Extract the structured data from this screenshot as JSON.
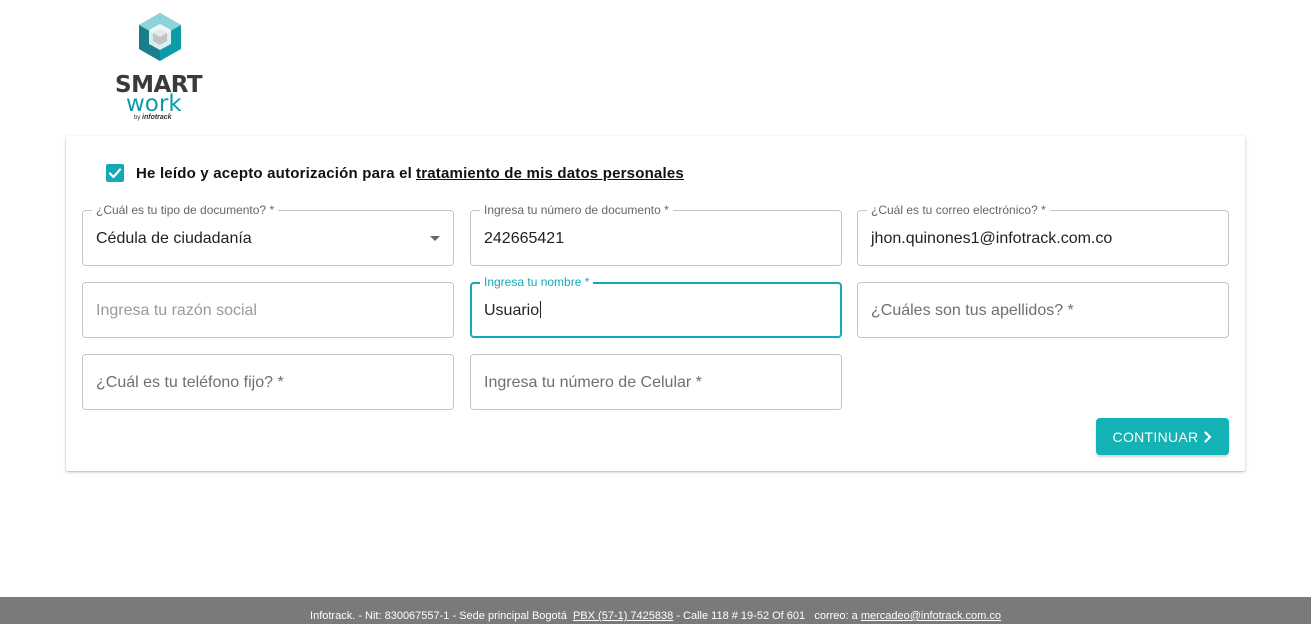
{
  "brand": {
    "line1": "SMART",
    "line2": "work",
    "by_prefix": "by",
    "by_name": "infotrack",
    "primary_color": "#12aab8",
    "dark_color": "#3a3a3a"
  },
  "consent": {
    "checked": true,
    "text": "He leído y acepto autorización para el",
    "link_text": "tratamiento de mis datos personales"
  },
  "fields": {
    "doc_type": {
      "label": "¿Cuál es tu tipo de documento? *",
      "value": "Cédula de ciudadanía"
    },
    "doc_number": {
      "label": "Ingresa tu número de documento *",
      "value": "242665421"
    },
    "email": {
      "label": "¿Cuál es tu correo electrónico? *",
      "value": "jhon.quinones1@infotrack.com.co"
    },
    "business_name": {
      "placeholder": "Ingresa tu razón social"
    },
    "first_name": {
      "label": "Ingresa tu nombre *",
      "value": "Usuario"
    },
    "last_names": {
      "placeholder": "¿Cuáles son tus apellidos? *"
    },
    "landline": {
      "placeholder": "¿Cuál es tu teléfono fijo? *"
    },
    "mobile": {
      "placeholder": "Ingresa tu número de Celular *"
    }
  },
  "actions": {
    "continue_label": "CONTINUAR",
    "button_color": "#12b2b5"
  },
  "footer": {
    "company": "Infotrack. - Nit: 830067557-1 - Sede principal Bogotá",
    "phone": "PBX (57-1) 7425838",
    "address": "- Calle 118 # 19-52 Of 601",
    "email_prefix": "correo: a",
    "email": "mercadeo@infotrack.com.co",
    "background": "#7a7a7a"
  }
}
